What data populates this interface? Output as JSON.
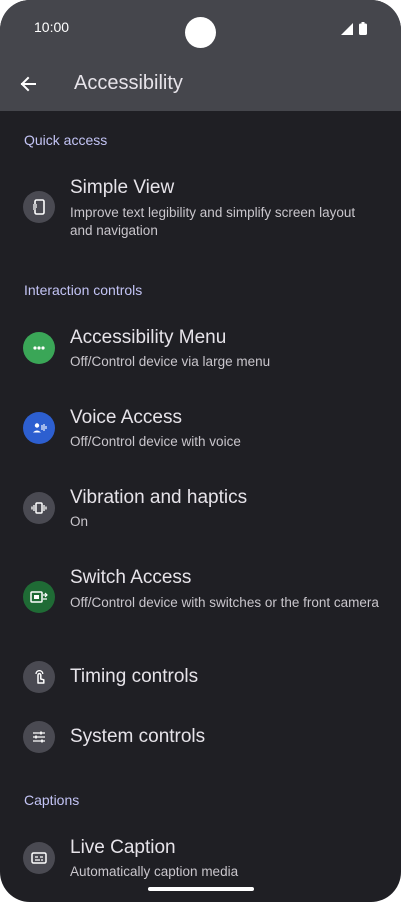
{
  "status_bar": {
    "time": "10:00"
  },
  "header": {
    "title": "Accessibility"
  },
  "sections": {
    "quick_access": "Quick access",
    "interaction_controls": "Interaction controls",
    "captions": "Captions"
  },
  "items": {
    "simple_view": {
      "title": "Simple View",
      "subtitle": "Improve text legibility and simplify screen layout and navigation",
      "icon": "phone-text-icon"
    },
    "accessibility_menu": {
      "title": "Accessibility Menu",
      "subtitle": "Off/Control device via large menu",
      "icon": "more-dots-icon"
    },
    "voice_access": {
      "title": "Voice Access",
      "subtitle": "Off/Control device with voice",
      "icon": "voice-person-icon"
    },
    "vibration": {
      "title": "Vibration and haptics",
      "subtitle": "On",
      "icon": "vibration-icon"
    },
    "switch_access": {
      "title": "Switch Access",
      "subtitle": "Off/Control device with switches or the front camera",
      "icon": "switch-access-icon"
    },
    "timing_controls": {
      "title": "Timing controls",
      "icon": "touch-hand-icon"
    },
    "system_controls": {
      "title": "System controls",
      "icon": "sliders-icon"
    },
    "live_caption": {
      "title": "Live Caption",
      "subtitle": "Automatically caption media",
      "icon": "caption-icon"
    }
  },
  "colors": {
    "background": "#1f1f24",
    "header": "#45464c",
    "section_label": "#c3c4f5",
    "accent_green": "#3aa657",
    "accent_blue": "#2d5fd0",
    "accent_dark_green": "#1f6b35"
  }
}
